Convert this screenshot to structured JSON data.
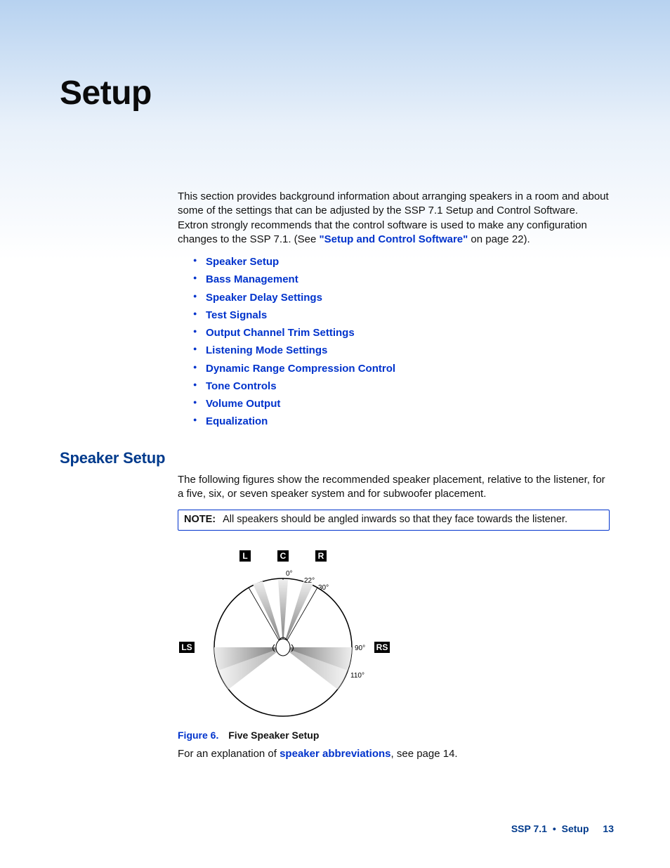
{
  "title": "Setup",
  "intro": {
    "pre": "This section provides background information about arranging speakers in a room and about some of the settings that can be adjusted by the SSP 7.1 Setup and Control Software. Extron strongly recommends that the control software is used to make any configuration changes to the SSP 7.1. (See ",
    "link": "\"Setup and Control Software\"",
    "post": " on page 22)."
  },
  "toc": [
    "Speaker Setup",
    "Bass Management",
    "Speaker Delay Settings",
    "Test Signals",
    "Output Channel Trim Settings",
    "Listening Mode Settings",
    "Dynamic Range Compression Control",
    "Tone Controls",
    "Volume Output",
    "Equalization"
  ],
  "section_heading": "Speaker Setup",
  "section_intro": "The following figures show the recommended speaker placement, relative to the listener, for a five, six, or seven speaker system and for subwoofer placement.",
  "note": {
    "label": "NOTE:",
    "text": "All speakers should be angled inwards so that they face towards the listener."
  },
  "figure": {
    "labels": {
      "L": "L",
      "C": "C",
      "R": "R",
      "LS": "LS",
      "RS": "RS"
    },
    "angles": {
      "a0": "0°",
      "a22": "22°",
      "a30": "30°",
      "a90": "90°",
      "a110": "110°"
    },
    "number": "Figure 6.",
    "title": "Five Speaker Setup"
  },
  "explanation": {
    "pre": "For an explanation of ",
    "link": "speaker abbreviations",
    "post": ", see page 14."
  },
  "footer": {
    "product": "SSP 7.1",
    "section": "Setup",
    "page": "13"
  }
}
